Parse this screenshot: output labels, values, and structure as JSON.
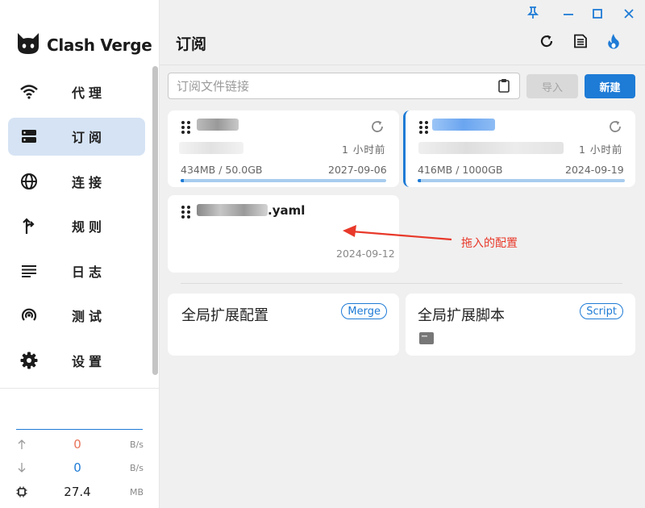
{
  "app": {
    "name": "Clash Verge"
  },
  "colors": {
    "accent": "#1e7bd6",
    "upload": "#e8745a",
    "annotation": "#e8392a"
  },
  "sidebar": {
    "items": [
      {
        "label": "代理",
        "icon": "wifi-icon"
      },
      {
        "label": "订阅",
        "icon": "server-icon",
        "active": true
      },
      {
        "label": "连接",
        "icon": "globe-icon"
      },
      {
        "label": "规则",
        "icon": "fork-icon"
      },
      {
        "label": "日志",
        "icon": "list-icon"
      },
      {
        "label": "测试",
        "icon": "radar-icon"
      },
      {
        "label": "设置",
        "icon": "gear-icon"
      }
    ],
    "traffic": {
      "up_value": "0",
      "up_unit": "B/s",
      "down_value": "0",
      "down_unit": "B/s",
      "mem_value": "27.4",
      "mem_unit": "MB"
    }
  },
  "header": {
    "title": "订阅"
  },
  "toolbar": {
    "url_placeholder": "订阅文件链接",
    "import_label": "导入",
    "new_label": "新建"
  },
  "subscriptions": [
    {
      "time": "1 小时前",
      "usage": "434MB / 50.0GB",
      "expire": "2027-09-06",
      "progress": 0.01
    },
    {
      "time": "1 小时前",
      "usage": "416MB / 1000GB",
      "expire": "2024-09-19",
      "progress": 0.01,
      "selected": true
    }
  ],
  "local_profile": {
    "title_suffix": ".yaml",
    "date": "2024-09-12"
  },
  "annotation": {
    "text": "拖入的配置"
  },
  "extensions": [
    {
      "title": "全局扩展配置",
      "tag": "Merge"
    },
    {
      "title": "全局扩展脚本",
      "tag": "Script"
    }
  ]
}
